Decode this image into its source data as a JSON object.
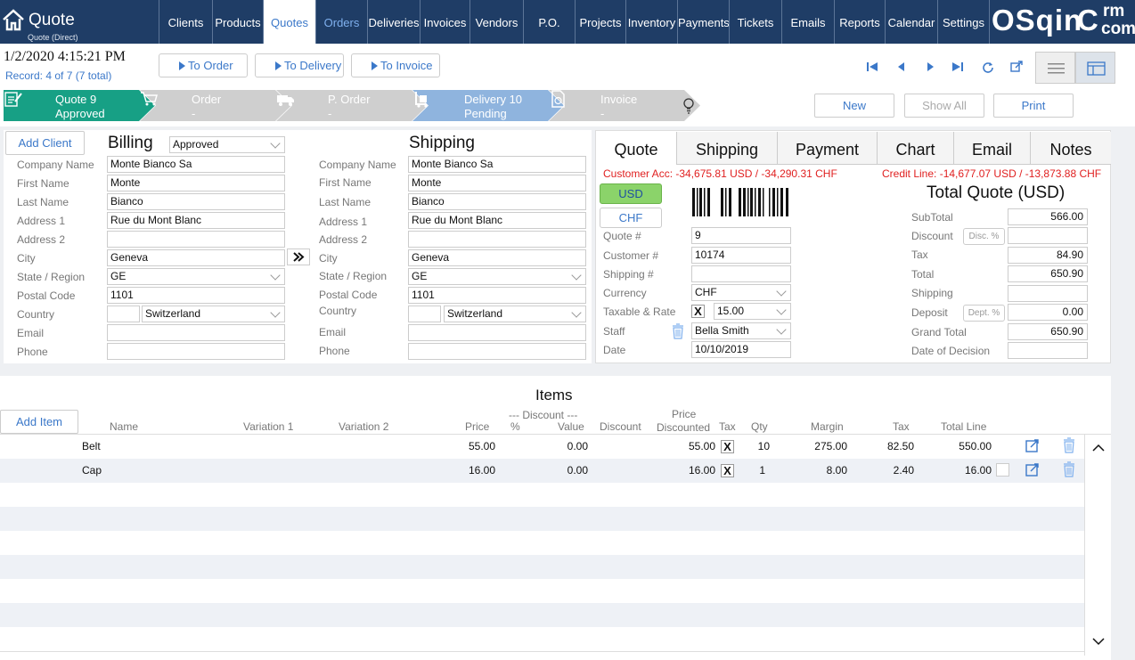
{
  "app": {
    "title": "Quote",
    "subtitle": "Quote (Direct)"
  },
  "nav": [
    {
      "label": "Clients"
    },
    {
      "label": "Products"
    },
    {
      "label": "Quotes"
    },
    {
      "label": "Orders"
    },
    {
      "label": "Deliveries"
    },
    {
      "label": "Invoices"
    },
    {
      "label": "Vendors"
    },
    {
      "label": "P.O."
    },
    {
      "label": "Projects"
    },
    {
      "label": "Inventory"
    },
    {
      "label": "Payments"
    },
    {
      "label": "Tickets"
    },
    {
      "label": "Emails"
    },
    {
      "label": "Reports"
    },
    {
      "label": "Calendar"
    },
    {
      "label": "Settings"
    }
  ],
  "logo": {
    "main": "OSqin",
    "c": "C",
    "rm": "rm",
    "com": "com"
  },
  "header": {
    "datetime": "1/2/2020 4:15:21 PM",
    "record": "Record:  4 of 7 (7 total)"
  },
  "actions": {
    "to_order": "To Order",
    "to_delivery": "To Delivery",
    "to_invoice": "To Invoice"
  },
  "workflow": [
    {
      "line1": "Quote 9",
      "line2": "Approved",
      "color": "#17a085"
    },
    {
      "line1": "Order",
      "line2": "-",
      "color": "#cfcfcf"
    },
    {
      "line1": "P. Order",
      "line2": "-",
      "color": "#cfcfcf"
    },
    {
      "line1": "Delivery 10",
      "line2": "Pending",
      "color": "#8fb4de"
    },
    {
      "line1": "Invoice",
      "line2": "-",
      "color": "#cfcfcf"
    }
  ],
  "buttons": {
    "new": "New",
    "show_all": "Show All",
    "print": "Print",
    "add_client": "Add Client",
    "add_item": "Add Item"
  },
  "billing": {
    "title": "Billing",
    "status": "Approved",
    "labels": {
      "company": "Company Name",
      "first": "First Name",
      "last": "Last Name",
      "addr1": "Address 1",
      "addr2": "Address 2",
      "city": "City",
      "state": "State / Region",
      "postal": "Postal Code",
      "country": "Country",
      "email": "Email",
      "phone": "Phone"
    },
    "company": "Monte Bianco Sa",
    "first": "Monte",
    "last": "Bianco",
    "addr1": "Rue du Mont Blanc",
    "addr2": "",
    "city": "Geneva",
    "state": "GE",
    "postal": "1101",
    "country_code": "",
    "country": "Switzerland",
    "email": "",
    "phone": ""
  },
  "shipping": {
    "title": "Shipping",
    "company": "Monte Bianco Sa",
    "first": "Monte",
    "last": "Bianco",
    "addr1": "Rue du Mont Blanc",
    "addr2": "",
    "city": "Geneva",
    "state": "GE",
    "postal": "1101",
    "country_code": "",
    "country": "Switzerland",
    "email": "",
    "phone": ""
  },
  "tabs": [
    {
      "label": "Quote"
    },
    {
      "label": "Shipping"
    },
    {
      "label": "Payment"
    },
    {
      "label": "Chart"
    },
    {
      "label": "Email"
    },
    {
      "label": "Notes"
    }
  ],
  "quote": {
    "customer_acc": "Customer Acc: -34,675.81 USD / -34,290.31 CHF",
    "credit_line": "Credit Line: -14,677.07 USD / -13,873.88 CHF",
    "cur_usd": "USD",
    "cur_chf": "CHF",
    "labels": {
      "quote_no": "Quote #",
      "customer_no": "Customer #",
      "shipping_no": "Shipping #",
      "currency": "Currency",
      "taxable": "Taxable & Rate",
      "staff": "Staff",
      "date": "Date"
    },
    "quote_no": "9",
    "customer_no": "10174",
    "shipping_no": "",
    "currency": "CHF",
    "taxable_check": "X",
    "rate": "15.00",
    "staff": "Bella Smith",
    "date": "10/10/2019"
  },
  "totals": {
    "title": "Total Quote (USD)",
    "labels": {
      "subtotal": "SubTotal",
      "discount": "Discount",
      "tax": "Tax",
      "total": "Total",
      "shipping": "Shipping",
      "deposit": "Deposit",
      "grand": "Grand Total",
      "decision": "Date of Decision"
    },
    "disc_btn": "Disc. %",
    "dept_btn": "Dept. %",
    "subtotal": "566.00",
    "discount": "",
    "tax": "84.90",
    "total": "650.90",
    "shipping": "",
    "deposit": "0.00",
    "grand": "650.90",
    "decision": ""
  },
  "items": {
    "title": "Items",
    "headers": {
      "name": "Name",
      "var1": "Variation 1",
      "var2": "Variation 2",
      "price": "Price",
      "discount_group": "--- Discount ---",
      "pct": "%",
      "value": "Value",
      "discount": "Discount",
      "price_disc_1": "Price",
      "price_disc_2": "Discounted",
      "tax": "Tax",
      "qty": "Qty",
      "margin": "Margin",
      "tax2": "Tax",
      "total_line": "Total Line"
    },
    "rows": [
      {
        "name": "Belt",
        "price": "55.00",
        "value": "0.00",
        "price_disc": "55.00",
        "tax_check": "X",
        "qty": "10",
        "margin": "275.00",
        "tax": "82.50",
        "total": "550.00"
      },
      {
        "name": "Cap",
        "price": "16.00",
        "value": "0.00",
        "price_disc": "16.00",
        "tax_check": "X",
        "qty": "1",
        "margin": "8.00",
        "tax": "2.40",
        "total": "16.00"
      }
    ]
  }
}
